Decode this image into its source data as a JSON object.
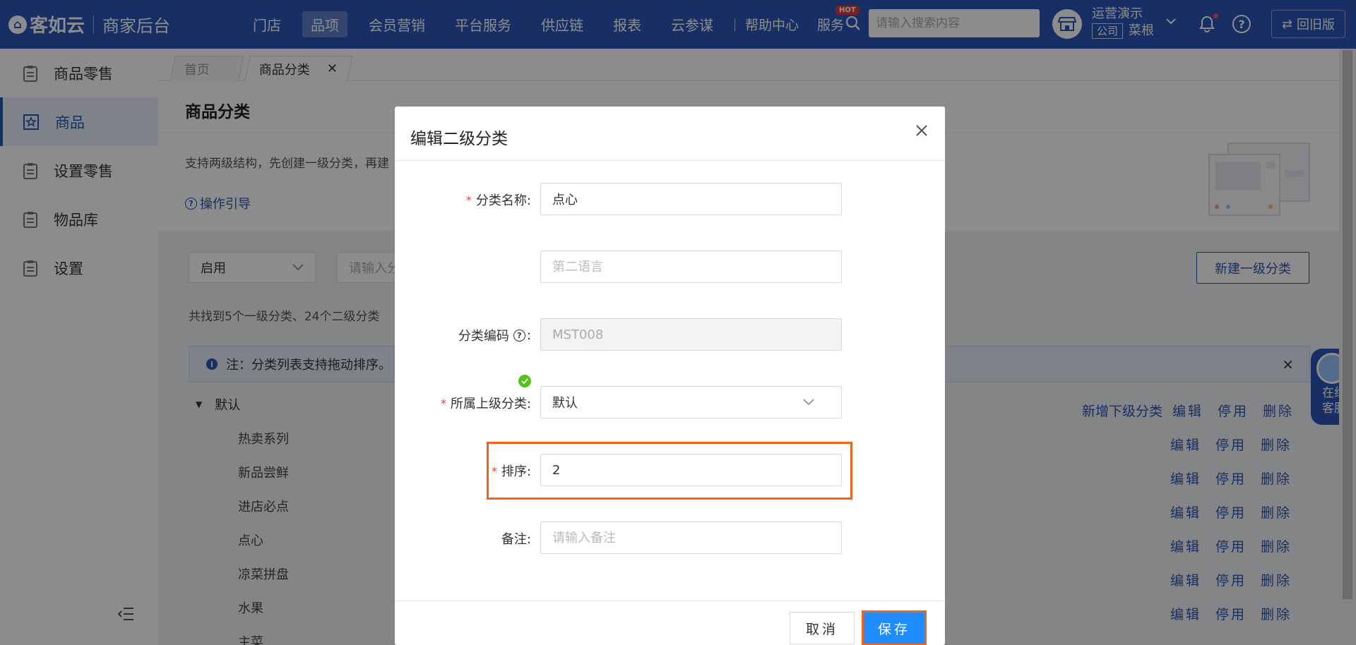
{
  "header": {
    "logo_brand": "客如云",
    "logo_sub": "商家后台",
    "nav": [
      "门店",
      "品项",
      "会员营销",
      "平台服务",
      "供应链",
      "报表",
      "云参谋"
    ],
    "nav_active_index": 1,
    "help": "帮助中心",
    "service": "服务",
    "hot_badge": "HOT",
    "search_placeholder": "请输入搜索内容",
    "account_name": "运营演示",
    "account_tag": "公司",
    "account_user": "菜根",
    "old_version": "回旧版"
  },
  "sidebar": {
    "items": [
      {
        "label": "商品零售",
        "active": false
      },
      {
        "label": "商品",
        "active": true
      },
      {
        "label": "设置零售",
        "active": false
      },
      {
        "label": "物品库",
        "active": false
      },
      {
        "label": "设置",
        "active": false
      }
    ]
  },
  "tabs": [
    {
      "label": "首页",
      "closable": false
    },
    {
      "label": "商品分类",
      "closable": true
    }
  ],
  "page": {
    "title": "商品分类",
    "description": "支持两级结构，先创建一级分类，再建",
    "guide_link": "操作引导",
    "filter_status": "启用",
    "filter_placeholder": "请输入分",
    "new_button": "新建一级分类",
    "count_text": "共找到5个一级分类、24个二级分类",
    "note_text": "注：分类列表支持拖动排序。",
    "tree_root": "默认",
    "tree_children": [
      "热卖系列",
      "新品尝鲜",
      "进店必点",
      "点心",
      "凉菜拼盘",
      "水果",
      "主菜"
    ],
    "root_actions": [
      "新增下级分类",
      "编辑",
      "停用",
      "删除"
    ],
    "child_actions": [
      "编辑",
      "停用",
      "删除"
    ],
    "float_service": [
      "在线",
      "客服"
    ]
  },
  "modal": {
    "title": "编辑二级分类",
    "fields": {
      "name": {
        "label": "分类名称:",
        "required": true,
        "value": "点心"
      },
      "second_lang": {
        "label": "",
        "placeholder": "第二语言",
        "value": ""
      },
      "code": {
        "label": "分类编码",
        "value": "MST008",
        "disabled": true
      },
      "parent": {
        "label": "所属上级分类:",
        "required": true,
        "value": "默认"
      },
      "sort": {
        "label": "排序:",
        "required": true,
        "value": "2"
      },
      "remark": {
        "label": "备注:",
        "placeholder": "请输入备注",
        "value": ""
      }
    },
    "cancel": "取消",
    "save": "保存"
  },
  "colors": {
    "brand": "#2a56b8",
    "primary_button": "#1f8cff",
    "highlight": "#f0651e",
    "required": "#e64242",
    "success": "#52c41a"
  }
}
